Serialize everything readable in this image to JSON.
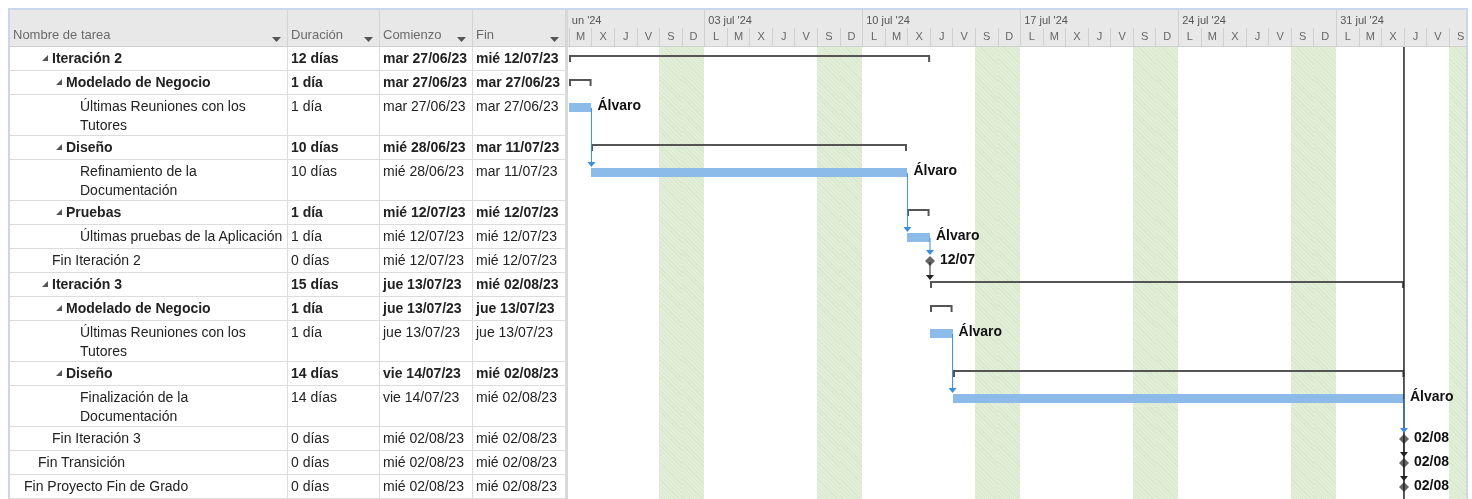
{
  "columns": [
    {
      "label": "Nombre de tarea"
    },
    {
      "label": "Duración"
    },
    {
      "label": "Comienzo"
    },
    {
      "label": "Fin"
    }
  ],
  "timescale": {
    "weeks": [
      "un '24",
      "03 jul '24",
      "10 jul '24",
      "17 jul '24",
      "24 jul '24",
      "31 jul '24"
    ],
    "days": [
      {
        "label": "M",
        "nonworking": false
      },
      {
        "label": "X",
        "nonworking": false
      },
      {
        "label": "J",
        "nonworking": false
      },
      {
        "label": "V",
        "nonworking": false
      },
      {
        "label": "S",
        "nonworking": true
      },
      {
        "label": "D",
        "nonworking": true
      },
      {
        "label": "L",
        "nonworking": false
      },
      {
        "label": "M",
        "nonworking": false
      },
      {
        "label": "X",
        "nonworking": false
      },
      {
        "label": "J",
        "nonworking": false
      },
      {
        "label": "V",
        "nonworking": false
      },
      {
        "label": "S",
        "nonworking": true
      },
      {
        "label": "D",
        "nonworking": true
      },
      {
        "label": "L",
        "nonworking": false
      },
      {
        "label": "M",
        "nonworking": false
      },
      {
        "label": "X",
        "nonworking": false
      },
      {
        "label": "J",
        "nonworking": false
      },
      {
        "label": "V",
        "nonworking": false
      },
      {
        "label": "S",
        "nonworking": true
      },
      {
        "label": "D",
        "nonworking": true
      },
      {
        "label": "L",
        "nonworking": false
      },
      {
        "label": "M",
        "nonworking": false
      },
      {
        "label": "X",
        "nonworking": false
      },
      {
        "label": "J",
        "nonworking": false
      },
      {
        "label": "V",
        "nonworking": false
      },
      {
        "label": "S",
        "nonworking": true
      },
      {
        "label": "D",
        "nonworking": true
      },
      {
        "label": "L",
        "nonworking": false
      },
      {
        "label": "M",
        "nonworking": false
      },
      {
        "label": "X",
        "nonworking": false
      },
      {
        "label": "J",
        "nonworking": false
      },
      {
        "label": "V",
        "nonworking": false
      },
      {
        "label": "S",
        "nonworking": true
      },
      {
        "label": "D",
        "nonworking": true
      },
      {
        "label": "L",
        "nonworking": false
      },
      {
        "label": "M",
        "nonworking": false
      },
      {
        "label": "X",
        "nonworking": false
      },
      {
        "label": "J",
        "nonworking": false
      },
      {
        "label": "V",
        "nonworking": false
      },
      {
        "label": "S",
        "nonworking": true
      }
    ]
  },
  "outline": [
    {
      "children": [
        {
          "children": [
            {
              "kind": "summary",
              "name": "Iteración 2",
              "duration": "12 días",
              "start": "mar 27/06/23",
              "finish": "mié 12/07/23",
              "expanded": true,
              "children": [
                {
                  "kind": "summary",
                  "name": "Modelado de Negocio",
                  "duration": "1 día",
                  "start": "mar 27/06/23",
                  "finish": "mar 27/06/23",
                  "expanded": true,
                  "children": [
                    {
                      "kind": "task",
                      "name": "Últimas Reuniones con los Tutores",
                      "duration": "1 día",
                      "start": "mar 27/06/23",
                      "finish": "mar 27/06/23",
                      "bar_label": "Álvaro"
                    }
                  ]
                },
                {
                  "kind": "summary",
                  "name": "Diseño",
                  "duration": "10 días",
                  "start": "mié 28/06/23",
                  "finish": "mar 11/07/23",
                  "expanded": true,
                  "children": [
                    {
                      "kind": "task",
                      "name": "Refinamiento de la Documentación",
                      "duration": "10 días",
                      "start": "mié 28/06/23",
                      "finish": "mar 11/07/23",
                      "bar_label": "Álvaro"
                    }
                  ]
                },
                {
                  "kind": "summary",
                  "name": "Pruebas",
                  "duration": "1 día",
                  "start": "mié 12/07/23",
                  "finish": "mié 12/07/23",
                  "expanded": true,
                  "children": [
                    {
                      "kind": "task",
                      "name": "Últimas pruebas de la Aplicación",
                      "duration": "1 día",
                      "start": "mié 12/07/23",
                      "finish": "mié 12/07/23",
                      "bar_label": "Álvaro"
                    }
                  ]
                }
              ]
            },
            {
              "kind": "milestone",
              "name": "Fin Iteración 2",
              "duration": "0 días",
              "start": "mié 12/07/23",
              "finish": "mié 12/07/23",
              "bar_label": "12/07"
            },
            {
              "kind": "summary",
              "name": "Iteración 3",
              "duration": "15 días",
              "start": "jue 13/07/23",
              "finish": "mié 02/08/23",
              "expanded": true,
              "children": [
                {
                  "kind": "summary",
                  "name": "Modelado de Negocio",
                  "duration": "1 día",
                  "start": "jue 13/07/23",
                  "finish": "jue 13/07/23",
                  "expanded": true,
                  "children": [
                    {
                      "kind": "task",
                      "name": "Últimas Reuniones con los Tutores",
                      "duration": "1 día",
                      "start": "jue 13/07/23",
                      "finish": "jue 13/07/23",
                      "bar_label": "Álvaro"
                    }
                  ]
                },
                {
                  "kind": "summary",
                  "name": "Diseño",
                  "duration": "14 días",
                  "start": "vie 14/07/23",
                  "finish": "mié 02/08/23",
                  "expanded": true,
                  "children": [
                    {
                      "kind": "task",
                      "name": "Finalización de la Documentación",
                      "duration": "14 días",
                      "start": "vie 14/07/23",
                      "finish": "mié 02/08/23",
                      "bar_label": "Álvaro"
                    }
                  ]
                }
              ]
            },
            {
              "kind": "milestone",
              "name": "Fin Iteración 3",
              "duration": "0 días",
              "start": "mié 02/08/23",
              "finish": "mié 02/08/23",
              "bar_label": "02/08"
            }
          ]
        },
        {
          "kind": "milestone",
          "name": "Fin Transición",
          "duration": "0 días",
          "start": "mié 02/08/23",
          "finish": "mié 02/08/23",
          "bar_label": "02/08"
        }
      ]
    },
    {
      "kind": "milestone",
      "name": "Fin Proyecto Fin de Grado",
      "duration": "0 días",
      "start": "mié 02/08/23",
      "finish": "mié 02/08/23",
      "bar_label": "02/08"
    }
  ]
}
